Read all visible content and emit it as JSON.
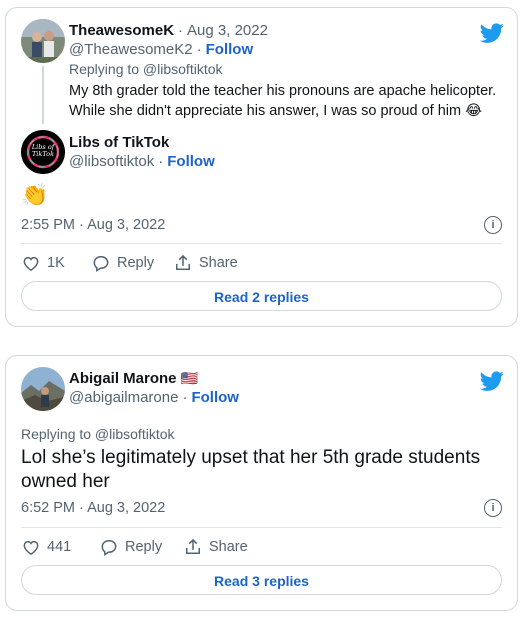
{
  "tweet1": {
    "parent": {
      "name": "TheawesomeK",
      "date": "Aug 3, 2022",
      "handle": "@TheawesomeK2",
      "follow": "Follow",
      "replying_to": "Replying to @libsoftiktok",
      "text_line1": "My 8th grader told the teacher his pronouns are apache helicopter.",
      "text_line2": "While she didn't appreciate his answer, I was so proud of him 😂"
    },
    "main": {
      "name": "Libs of TikTok",
      "handle": "@libsoftiktok",
      "follow": "Follow",
      "avatar_text": "Libs of TikTok",
      "emoji": "👏",
      "timestamp": "2:55 PM · Aug 3, 2022",
      "likes": "1K",
      "reply_label": "Reply",
      "share_label": "Share",
      "read_replies": "Read 2 replies"
    }
  },
  "tweet2": {
    "name": "Abigail Marone",
    "flag": "🇺🇸",
    "handle": "@abigailmarone",
    "follow": "Follow",
    "replying_to": "Replying to @libsoftiktok",
    "text_line1": "Lol she’s legitimately upset that her 5th grade students",
    "text_line2": "owned her",
    "timestamp": "6:52 PM · Aug 3, 2022",
    "likes": "441",
    "reply_label": "Reply",
    "share_label": "Share",
    "read_replies": "Read 3 replies"
  },
  "colors": {
    "twitter_blue": "#1d9bf0",
    "link_blue": "#1d64c8",
    "muted": "#536471",
    "border": "#cfd9de"
  },
  "icons": [
    "twitter-bird-icon",
    "heart-icon",
    "reply-bubble-icon",
    "share-icon",
    "info-icon"
  ]
}
